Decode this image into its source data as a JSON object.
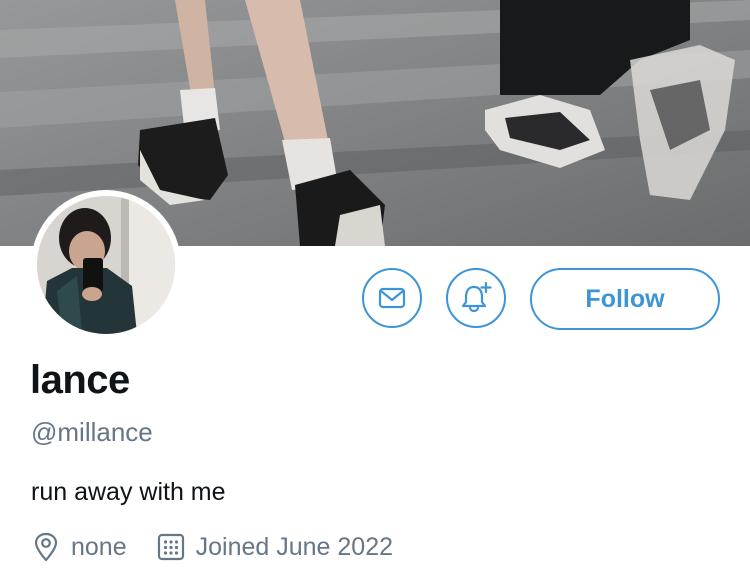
{
  "profile": {
    "display_name": "lance",
    "handle": "@millance",
    "bio": "run away with me",
    "location": "none",
    "joined": "Joined June 2022"
  },
  "actions": {
    "follow_label": "Follow",
    "message_icon": "envelope-icon",
    "notify_icon": "bell-plus-icon"
  },
  "icons": {
    "location": "location-pin-icon",
    "joined": "calendar-icon"
  },
  "colors": {
    "accent": "#3d94d6",
    "secondary_text": "#657786",
    "primary_text": "#0f1419"
  }
}
